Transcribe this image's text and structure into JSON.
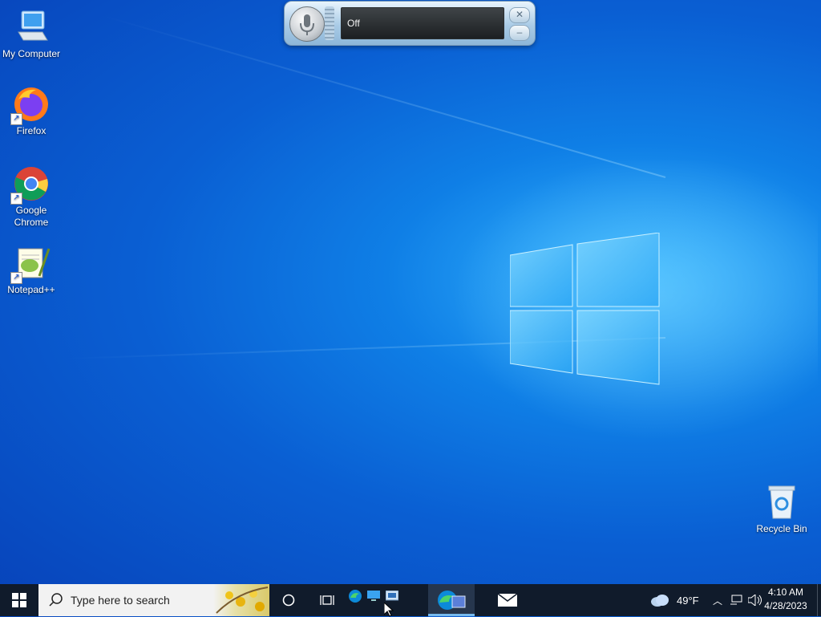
{
  "desktop": {
    "icons": [
      {
        "label": "My Computer"
      },
      {
        "label": "Firefox"
      },
      {
        "label": "Google Chrome"
      },
      {
        "label": "Notepad++"
      },
      {
        "label": "Recycle Bin"
      }
    ]
  },
  "speech_bar": {
    "status": "Off",
    "close_icon": "close-icon",
    "minimize_icon": "minimize-icon"
  },
  "taskbar": {
    "search_placeholder": "Type here to search",
    "pinned": [
      "cortana",
      "task-view",
      "edge",
      "remote-desktop",
      "remote-desktop-connection",
      "edge-active",
      "mail"
    ],
    "weather": {
      "temp": "49°F",
      "icon": "cloud-icon"
    },
    "clock": {
      "time": "4:10 AM",
      "date": "4/28/2023"
    }
  },
  "colors": {
    "taskbar": "#101b2b",
    "search_bg": "#f2f2f2",
    "accent": "#76b9ed"
  }
}
